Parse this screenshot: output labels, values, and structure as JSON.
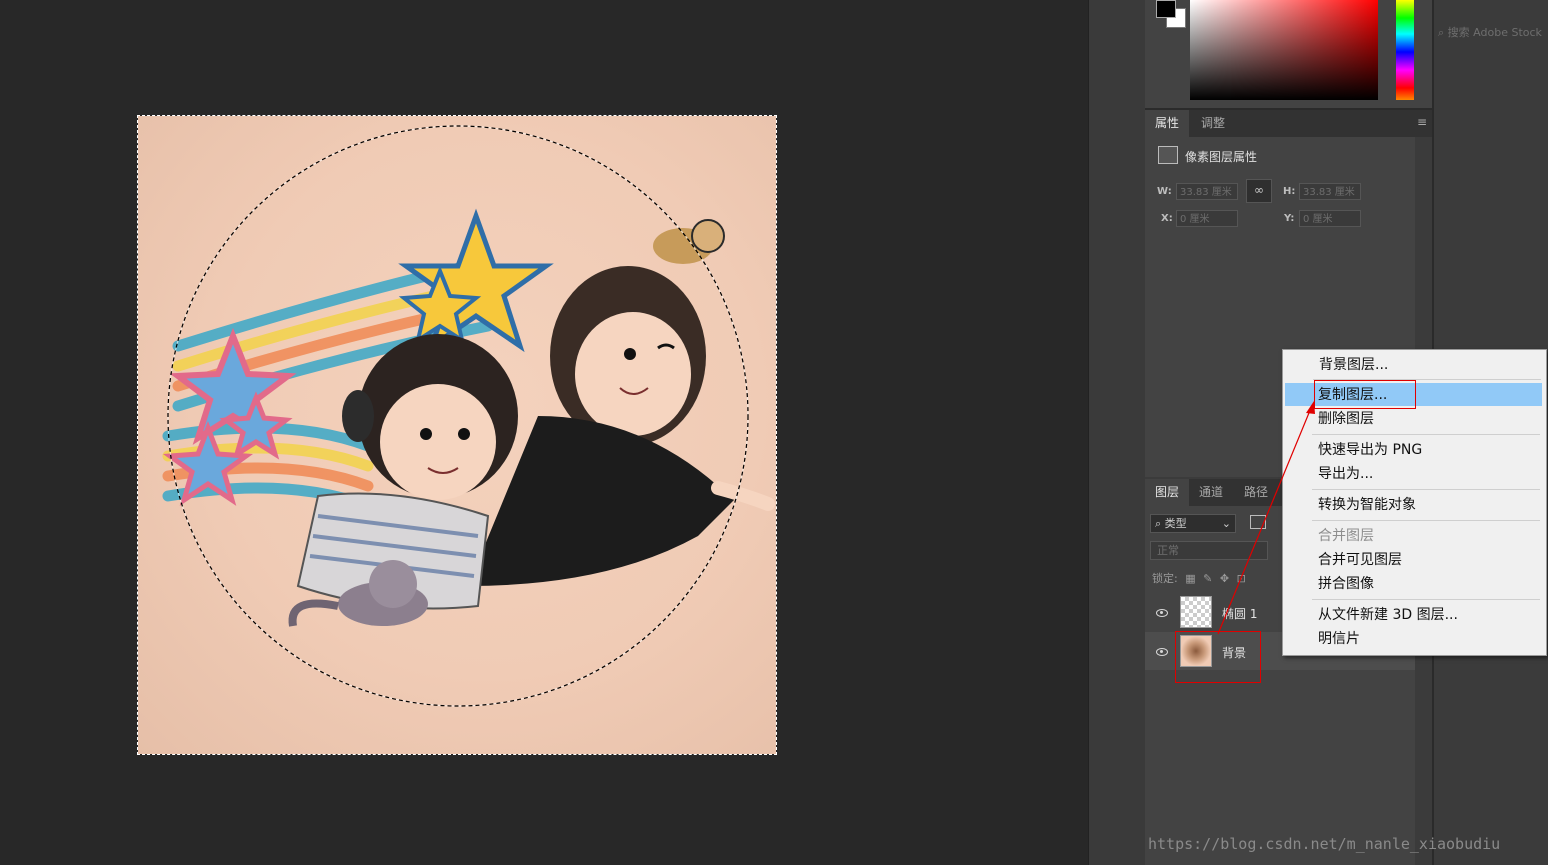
{
  "window": {
    "screenshot_size": "1548x865"
  },
  "colors": {
    "app_background": "#282828",
    "panel_background": "#434343",
    "menu_background": "#f0f0f0",
    "menu_highlight": "#91c9f7",
    "annotation_red": "#e00000"
  },
  "stock_search": {
    "placeholder": "搜索 Adobe Stock"
  },
  "properties": {
    "tabs": [
      {
        "label": "属性",
        "active": true
      },
      {
        "label": "调整",
        "active": false
      }
    ],
    "title": "像素图层属性",
    "w_label": "W:",
    "w_value": "33.83 厘米",
    "h_label": "H:",
    "h_value": "33.83 厘米",
    "x_label": "X:",
    "x_value": "0 厘米",
    "y_label": "Y:",
    "y_value": "0 厘米",
    "link_icon": "chain-link-icon"
  },
  "layers_panel": {
    "tabs": [
      {
        "label": "图层",
        "active": true
      },
      {
        "label": "通道",
        "active": false
      },
      {
        "label": "路径",
        "active": false
      }
    ],
    "kind_filter": "类型",
    "blend_mode": "正常",
    "lock_label": "锁定:",
    "layers": [
      {
        "name": "椭圆 1",
        "visible": true,
        "thumbnail": "transparent-checker"
      },
      {
        "name": "背景",
        "visible": true,
        "thumbnail": "artwork"
      }
    ]
  },
  "context_menu": {
    "items": [
      {
        "label": "背景图层...",
        "enabled": true,
        "highlighted": false
      },
      {
        "label": "复制图层...",
        "enabled": true,
        "highlighted": true
      },
      {
        "label": "删除图层",
        "enabled": true,
        "highlighted": false
      },
      {
        "label": "快速导出为 PNG",
        "enabled": true,
        "highlighted": false
      },
      {
        "label": "导出为...",
        "enabled": true,
        "highlighted": false
      },
      {
        "label": "转换为智能对象",
        "enabled": true,
        "highlighted": false
      },
      {
        "label": "合并图层",
        "enabled": false,
        "highlighted": false
      },
      {
        "label": "合并可见图层",
        "enabled": true,
        "highlighted": false
      },
      {
        "label": "拼合图像",
        "enabled": true,
        "highlighted": false
      },
      {
        "label": "从文件新建 3D 图层...",
        "enabled": true,
        "highlighted": false
      },
      {
        "label": "明信片",
        "enabled": true,
        "highlighted": false
      }
    ]
  },
  "watermark": "https://blog.csdn.net/m_nanle_xiaobudiu"
}
